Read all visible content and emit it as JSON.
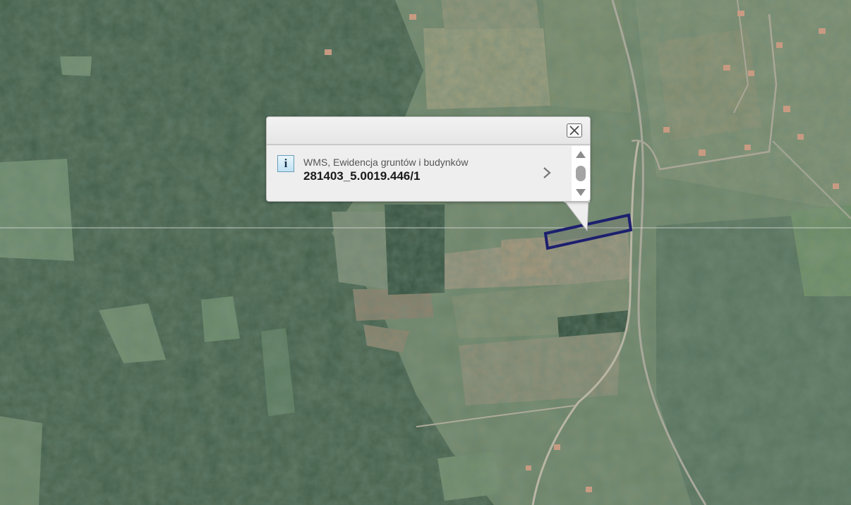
{
  "map": {
    "base_layer": "satellite imagery",
    "selection_outline_color": "#1c1f6e"
  },
  "popup": {
    "info_icon_glyph": "i",
    "layer_name": "WMS, Ewidencja gruntów i budynków",
    "parcel_id": "281403_5.0019.446/1",
    "icons": {
      "close": "close-icon",
      "info": "info-icon",
      "details": "chevron-right-icon",
      "scroll_up": "triangle-up-icon",
      "scroll_down": "triangle-down-icon"
    }
  }
}
